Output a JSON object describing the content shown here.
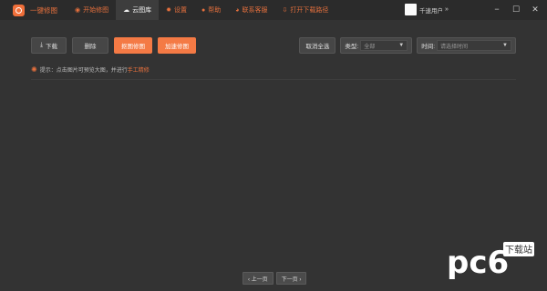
{
  "app": {
    "brand": "一键修图"
  },
  "nav": [
    {
      "icon": "camera-icon",
      "glyph": "◉",
      "label": "开始修图"
    },
    {
      "icon": "cloud-icon",
      "glyph": "☁",
      "label": "云图库",
      "active": true
    },
    {
      "icon": "gear-icon",
      "glyph": "✹",
      "label": "设置"
    },
    {
      "icon": "help-icon",
      "glyph": "●",
      "label": "帮助"
    },
    {
      "icon": "chat-icon",
      "glyph": "◕",
      "label": "联系客服"
    },
    {
      "icon": "download-icon",
      "glyph": "⇩",
      "label": "打开下载路径"
    }
  ],
  "user": {
    "name": "千速用户",
    "chevron": "»"
  },
  "window": {
    "minimize": "−",
    "maximize": "☐",
    "close": "✕"
  },
  "toolbar": {
    "download": "下载",
    "delete": "删除",
    "ai_retouch": "抠图修图",
    "add_retouch": "加速修图",
    "unselect_all": "取消全选"
  },
  "filters": {
    "type_label": "类型:",
    "type_value": "全部",
    "time_label": "时间:",
    "time_placeholder": "请选择时间"
  },
  "hint": {
    "text": "提示：点击图片可预览大图，并进行",
    "link": "手工精修"
  },
  "pager": {
    "prev": "‹ 上一页",
    "next": "下一页 ›"
  },
  "watermark": {
    "brand": "pc6",
    "sub": "下载站"
  },
  "colors": {
    "accent": "#f47a45",
    "background": "#333333",
    "titlebar": "#2b2b2b"
  }
}
